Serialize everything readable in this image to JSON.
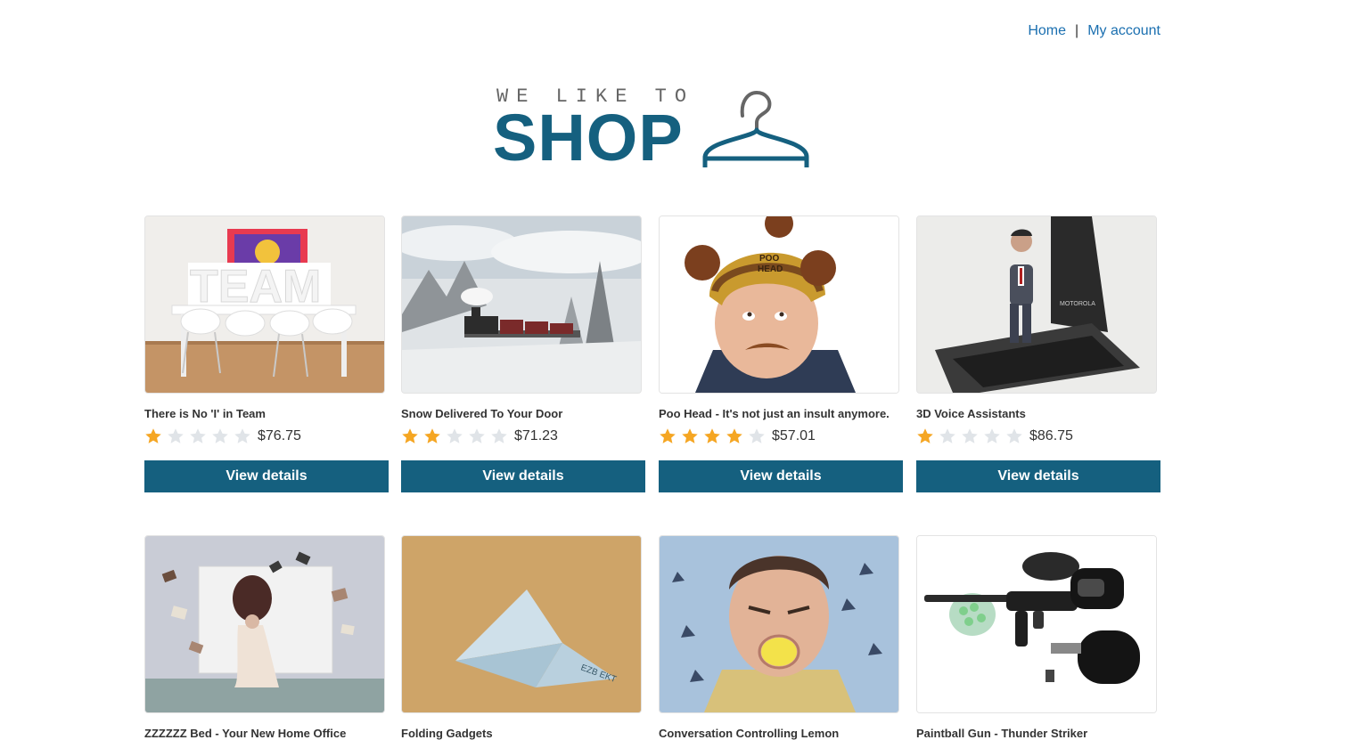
{
  "nav": {
    "home_label": "Home",
    "separator": "|",
    "account_label": "My account"
  },
  "logo": {
    "tagline": "WE LIKE TO",
    "word": "SHOP",
    "brand_color": "#15607f"
  },
  "products": [
    {
      "title": "There is No 'I' in Team",
      "rating": 1,
      "price": "$76.75",
      "button": "View details",
      "image": "team-meeting-room"
    },
    {
      "title": "Snow Delivered To Your Door",
      "rating": 2,
      "price": "$71.23",
      "button": "View details",
      "image": "steam-train-snow"
    },
    {
      "title": "Poo Head - It's not just an insult anymore.",
      "rating": 4,
      "price": "$57.01",
      "button": "View details",
      "image": "man-poo-hat"
    },
    {
      "title": "3D Voice Assistants",
      "rating": 1,
      "price": "$86.75",
      "button": "View details",
      "image": "hologram-phone"
    },
    {
      "title": "ZZZZZZ Bed - Your New Home Office",
      "image": "woman-flying-books"
    },
    {
      "title": "Folding Gadgets",
      "image": "origami-money-bird"
    },
    {
      "title": "Conversation Controlling Lemon",
      "image": "man-lemon-mouth"
    },
    {
      "title": "Paintball Gun - Thunder Striker",
      "image": "paintball-gun"
    }
  ],
  "colors": {
    "star_filled": "#f5a623",
    "star_empty": "#e0e4e8",
    "button_bg": "#15607f",
    "link": "#1a6fb0"
  }
}
